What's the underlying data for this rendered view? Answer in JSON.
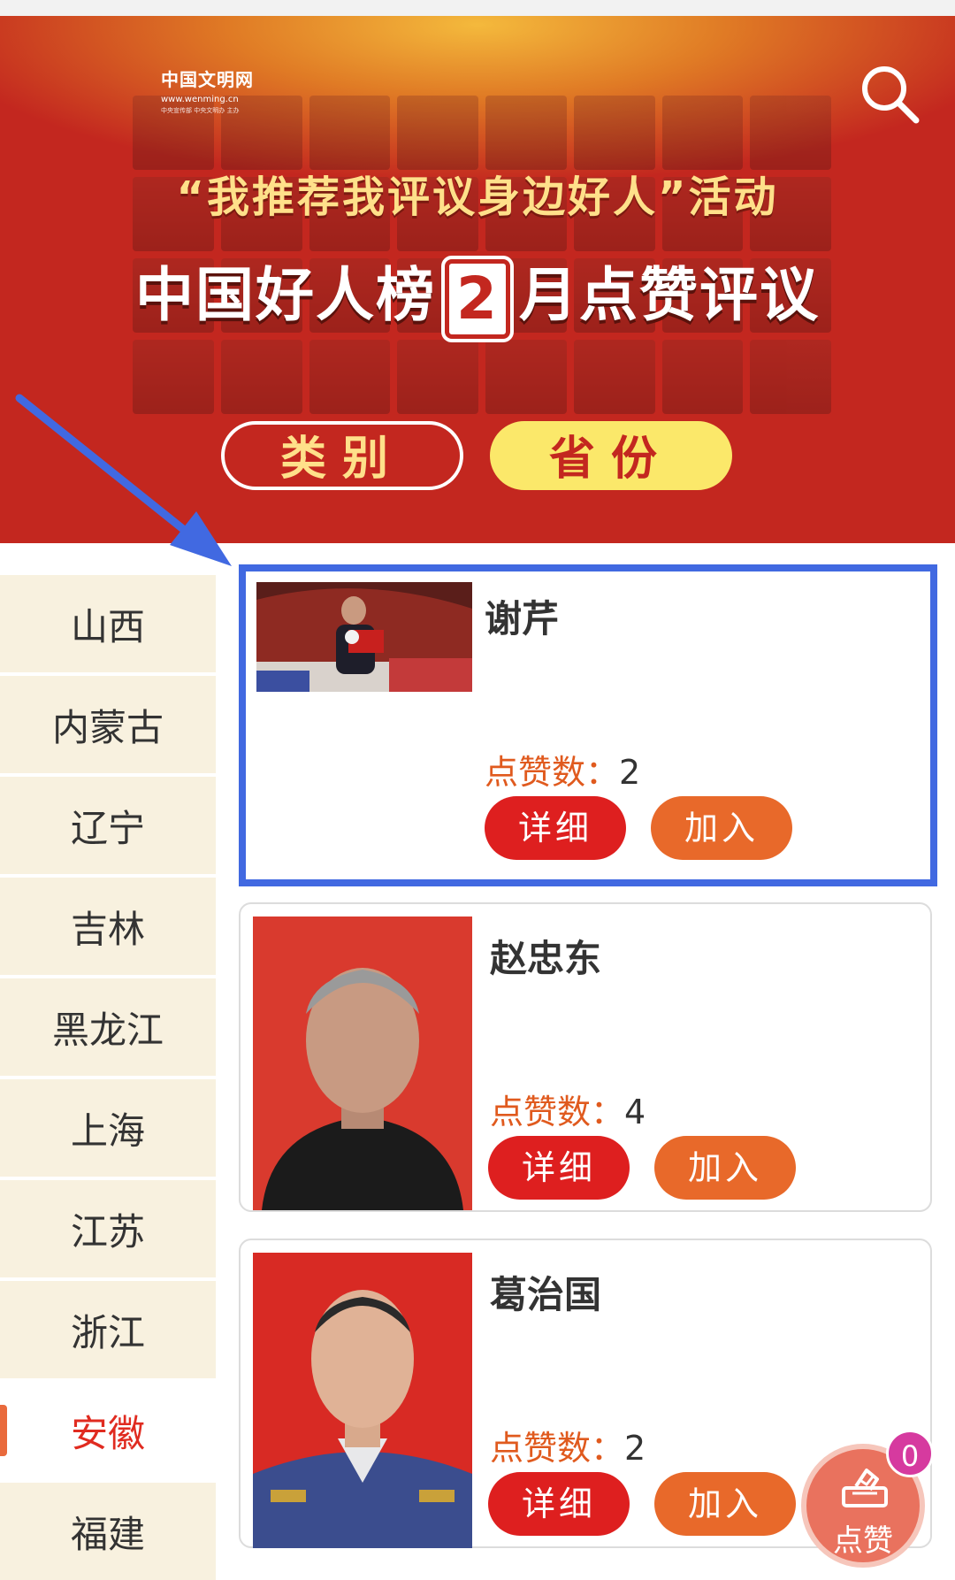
{
  "banner": {
    "logo_name": "中国文明网",
    "logo_url": "www.wenming.cn",
    "logo_sponsor": "中央宣传部 中央文明办 主办",
    "subtitle": "“我推荐我评议身边好人”活动",
    "headline_pre": "中国好人榜",
    "headline_month": "2",
    "headline_post": "月点赞评议",
    "tab_category": "类别",
    "tab_province": "省份"
  },
  "sidebar": {
    "items": [
      "山西",
      "内蒙古",
      "辽宁",
      "吉林",
      "黑龙江",
      "上海",
      "江苏",
      "浙江",
      "安徽",
      "福建"
    ],
    "active": "安徽"
  },
  "cards": [
    {
      "name": "谢芹",
      "likes_label": "点赞数：",
      "likes": "2",
      "detail_label": "详细",
      "join_label": "加入"
    },
    {
      "name": "赵忠东",
      "likes_label": "点赞数：",
      "likes": "4",
      "detail_label": "详细",
      "join_label": "加入"
    },
    {
      "name": "葛治国",
      "likes_label": "点赞数：",
      "likes": "2",
      "detail_label": "详细",
      "join_label": "加入"
    }
  ],
  "fab": {
    "label": "点赞",
    "badge": "0"
  },
  "colors": {
    "banner_red": "#c3271f",
    "highlight_blue": "#4169e1",
    "detail_red": "#de1f1f",
    "join_orange": "#e8692a",
    "sidebar_bg": "#f8f1df",
    "active_red": "#e02b20"
  }
}
